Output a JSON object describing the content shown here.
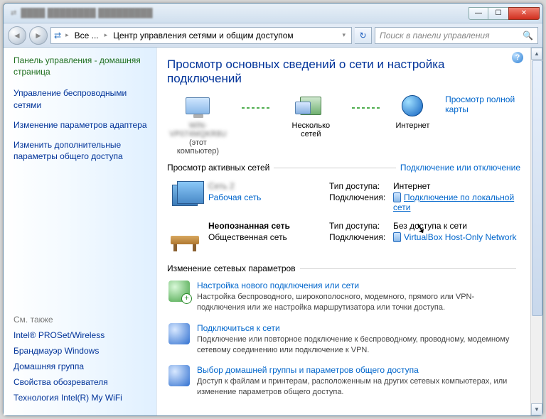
{
  "titlebar": {
    "min": "—",
    "max": "☐",
    "close": "✕"
  },
  "address": {
    "root_icon": "⇄",
    "crumb1": "Все ...",
    "crumb2": "Центр управления сетями и общим доступом",
    "search_placeholder": "Поиск в панели управления"
  },
  "sidebar": {
    "home": "Панель управления - домашняя страница",
    "tasks": [
      "Управление беспроводными сетями",
      "Изменение параметров адаптера",
      "Изменить дополнительные параметры общего доступа"
    ],
    "see_also": "См. также",
    "see_links": [
      "Intel® PROSet/Wireless",
      "Брандмауэр Windows",
      "Домашняя группа",
      "Свойства обозревателя",
      "Технология Intel(R) My WiFi"
    ]
  },
  "main": {
    "title": "Просмотр основных сведений о сети и настройка подключений",
    "full_map": "Просмотр полной карты",
    "nodes": {
      "pc_name": "WIN-VP074MQKR8U",
      "pc_sub": "(этот компьютер)",
      "mid": "Несколько сетей",
      "net": "Интернет"
    },
    "active_head": "Просмотр активных сетей",
    "active_link": "Подключение или отключение",
    "entries": [
      {
        "name": "Сеть 2",
        "type_link": "Рабочая сеть",
        "access_lbl": "Тип доступа:",
        "access_val": "Интернет",
        "conn_lbl": "Подключения:",
        "conn_link": "Подключение по локальной сети"
      },
      {
        "name": "Неопознанная сеть",
        "type_plain": "Общественная сеть",
        "access_lbl": "Тип доступа:",
        "access_val": "Без доступа к сети",
        "conn_lbl": "Подключения:",
        "conn_link": "VirtualBox Host-Only Network"
      }
    ],
    "change_head": "Изменение сетевых параметров",
    "change_items": [
      {
        "title": "Настройка нового подключения или сети",
        "desc": "Настройка беспроводного, широкополосного, модемного, прямого или VPN-подключения или же настройка маршрутизатора или точки доступа."
      },
      {
        "title": "Подключиться к сети",
        "desc": "Подключение или повторное подключение к беспроводному, проводному, модемному сетевому соединению или подключение к VPN."
      },
      {
        "title": "Выбор домашней группы и параметров общего доступа",
        "desc": "Доступ к файлам и принтерам, расположенным на других сетевых компьютерах, или изменение параметров общего доступа."
      }
    ]
  }
}
